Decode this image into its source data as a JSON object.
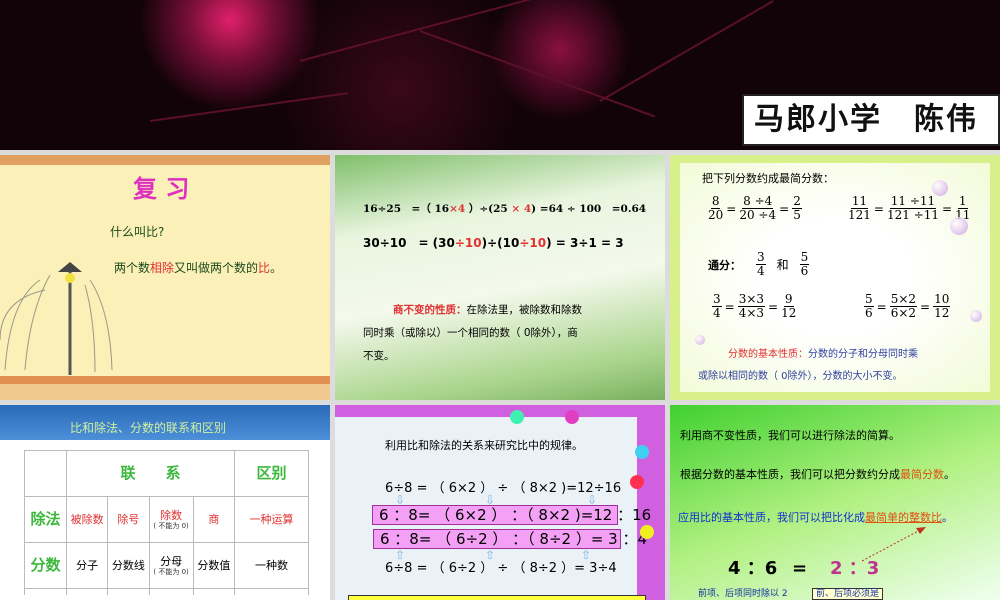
{
  "banner": {
    "school_label": "马郎小学　陈伟"
  },
  "slides": {
    "review": {
      "title": "复 习",
      "question": "什么叫比?",
      "answer_a": "两个数",
      "answer_b": "相除",
      "answer_c": "又叫做两个数的",
      "answer_d": "比",
      "answer_e": "。"
    },
    "quotient": {
      "eq1": [
        [
          "16÷25　=（ 16",
          ""
        ],
        [
          "×4",
          "r"
        ],
        [
          " ）÷(25 ",
          ""
        ],
        [
          "× 4",
          "r"
        ],
        [
          ")  =64 ÷ 100　=0.64",
          ""
        ]
      ],
      "eq2": [
        [
          "30÷10　= (30",
          ""
        ],
        [
          "÷10",
          "r"
        ],
        [
          ")÷(10",
          ""
        ],
        [
          "÷10",
          "r"
        ],
        [
          ")  = 3÷1  = 3",
          ""
        ]
      ],
      "rule_label": "商不变的性质：",
      "rule_line1": "在除法里，被除数和除数",
      "rule_line2": "同时乘（或除以）一个相同的数（ 0除外），商",
      "rule_line3": "不变。"
    },
    "fractions": {
      "title": "把下列分数约成最简分数：",
      "ex1": {
        "a": [
          "8",
          "20"
        ],
        "b": [
          "8 ÷4",
          "20 ÷4"
        ],
        "c": [
          "2",
          "5"
        ]
      },
      "ex2": {
        "a": [
          "11",
          "121"
        ],
        "b": [
          "11 ÷11",
          "121 ÷11"
        ],
        "c": [
          "1",
          "11"
        ]
      },
      "common_label": "通分：",
      "and": "和",
      "f1": [
        "3",
        "4"
      ],
      "f2": [
        "5",
        "6"
      ],
      "ex3": {
        "a": [
          "3",
          "4"
        ],
        "b": [
          "3×3",
          "4×3"
        ],
        "c": [
          "9",
          "12"
        ]
      },
      "ex4": {
        "a": [
          "5",
          "6"
        ],
        "b": [
          "5×2",
          "6×2"
        ],
        "c": [
          "10",
          "12"
        ]
      },
      "rule_label": "分数的基本性质：",
      "rule_line1": "分数的分子和分母同时乘",
      "rule_line2": "或除以相同的数（ 0除外），分数的大小不变。"
    },
    "relation": {
      "title": "比和除法、分数的联系和区别",
      "header": [
        "",
        "联　　系",
        "区别"
      ],
      "rows": [
        {
          "label": "除法",
          "cells": [
            "被除数",
            "除号",
            "除数",
            "商",
            "一种运算"
          ],
          "note": "( 不能为 0)"
        },
        {
          "label": "分数",
          "cells": [
            "分子",
            "分数线",
            "分母",
            "分数值",
            "一种数"
          ],
          "note": "( 不能为 0)"
        }
      ]
    },
    "ratio_rule": {
      "title": "利用比和除法的关系来研究比中的规律。",
      "l1": "6÷8 = （ 6×2 ） ÷ （ 8×2 )=12÷16",
      "l2": "6 ：8= （ 6×2 ） ：（ 8×2 )=12 ：16",
      "l3": "6 ：8= （ 6÷2 ） ：（ 8÷2 ）= 3 ：4",
      "l4": "6÷8 = （ 6÷2 ） ÷ （ 8÷2 ）= 3÷4"
    },
    "summary": {
      "line1": "利用商不变性质，我们可以进行除法的简算。",
      "line2a": "根据分数的基本性质，我们可以把分数约分成",
      "line2b": "最简分数",
      "line2c": "。",
      "line3a": "应用比的基本性质，我们可以把比化成",
      "line3b": "最简单的整数比",
      "line3c": "。",
      "eq_left": "4 ：6",
      "eq_sign": "=",
      "eq_right": "2 ：3",
      "note1": "前项、后项同时除以 2",
      "note2": "前、后项必须是"
    }
  }
}
